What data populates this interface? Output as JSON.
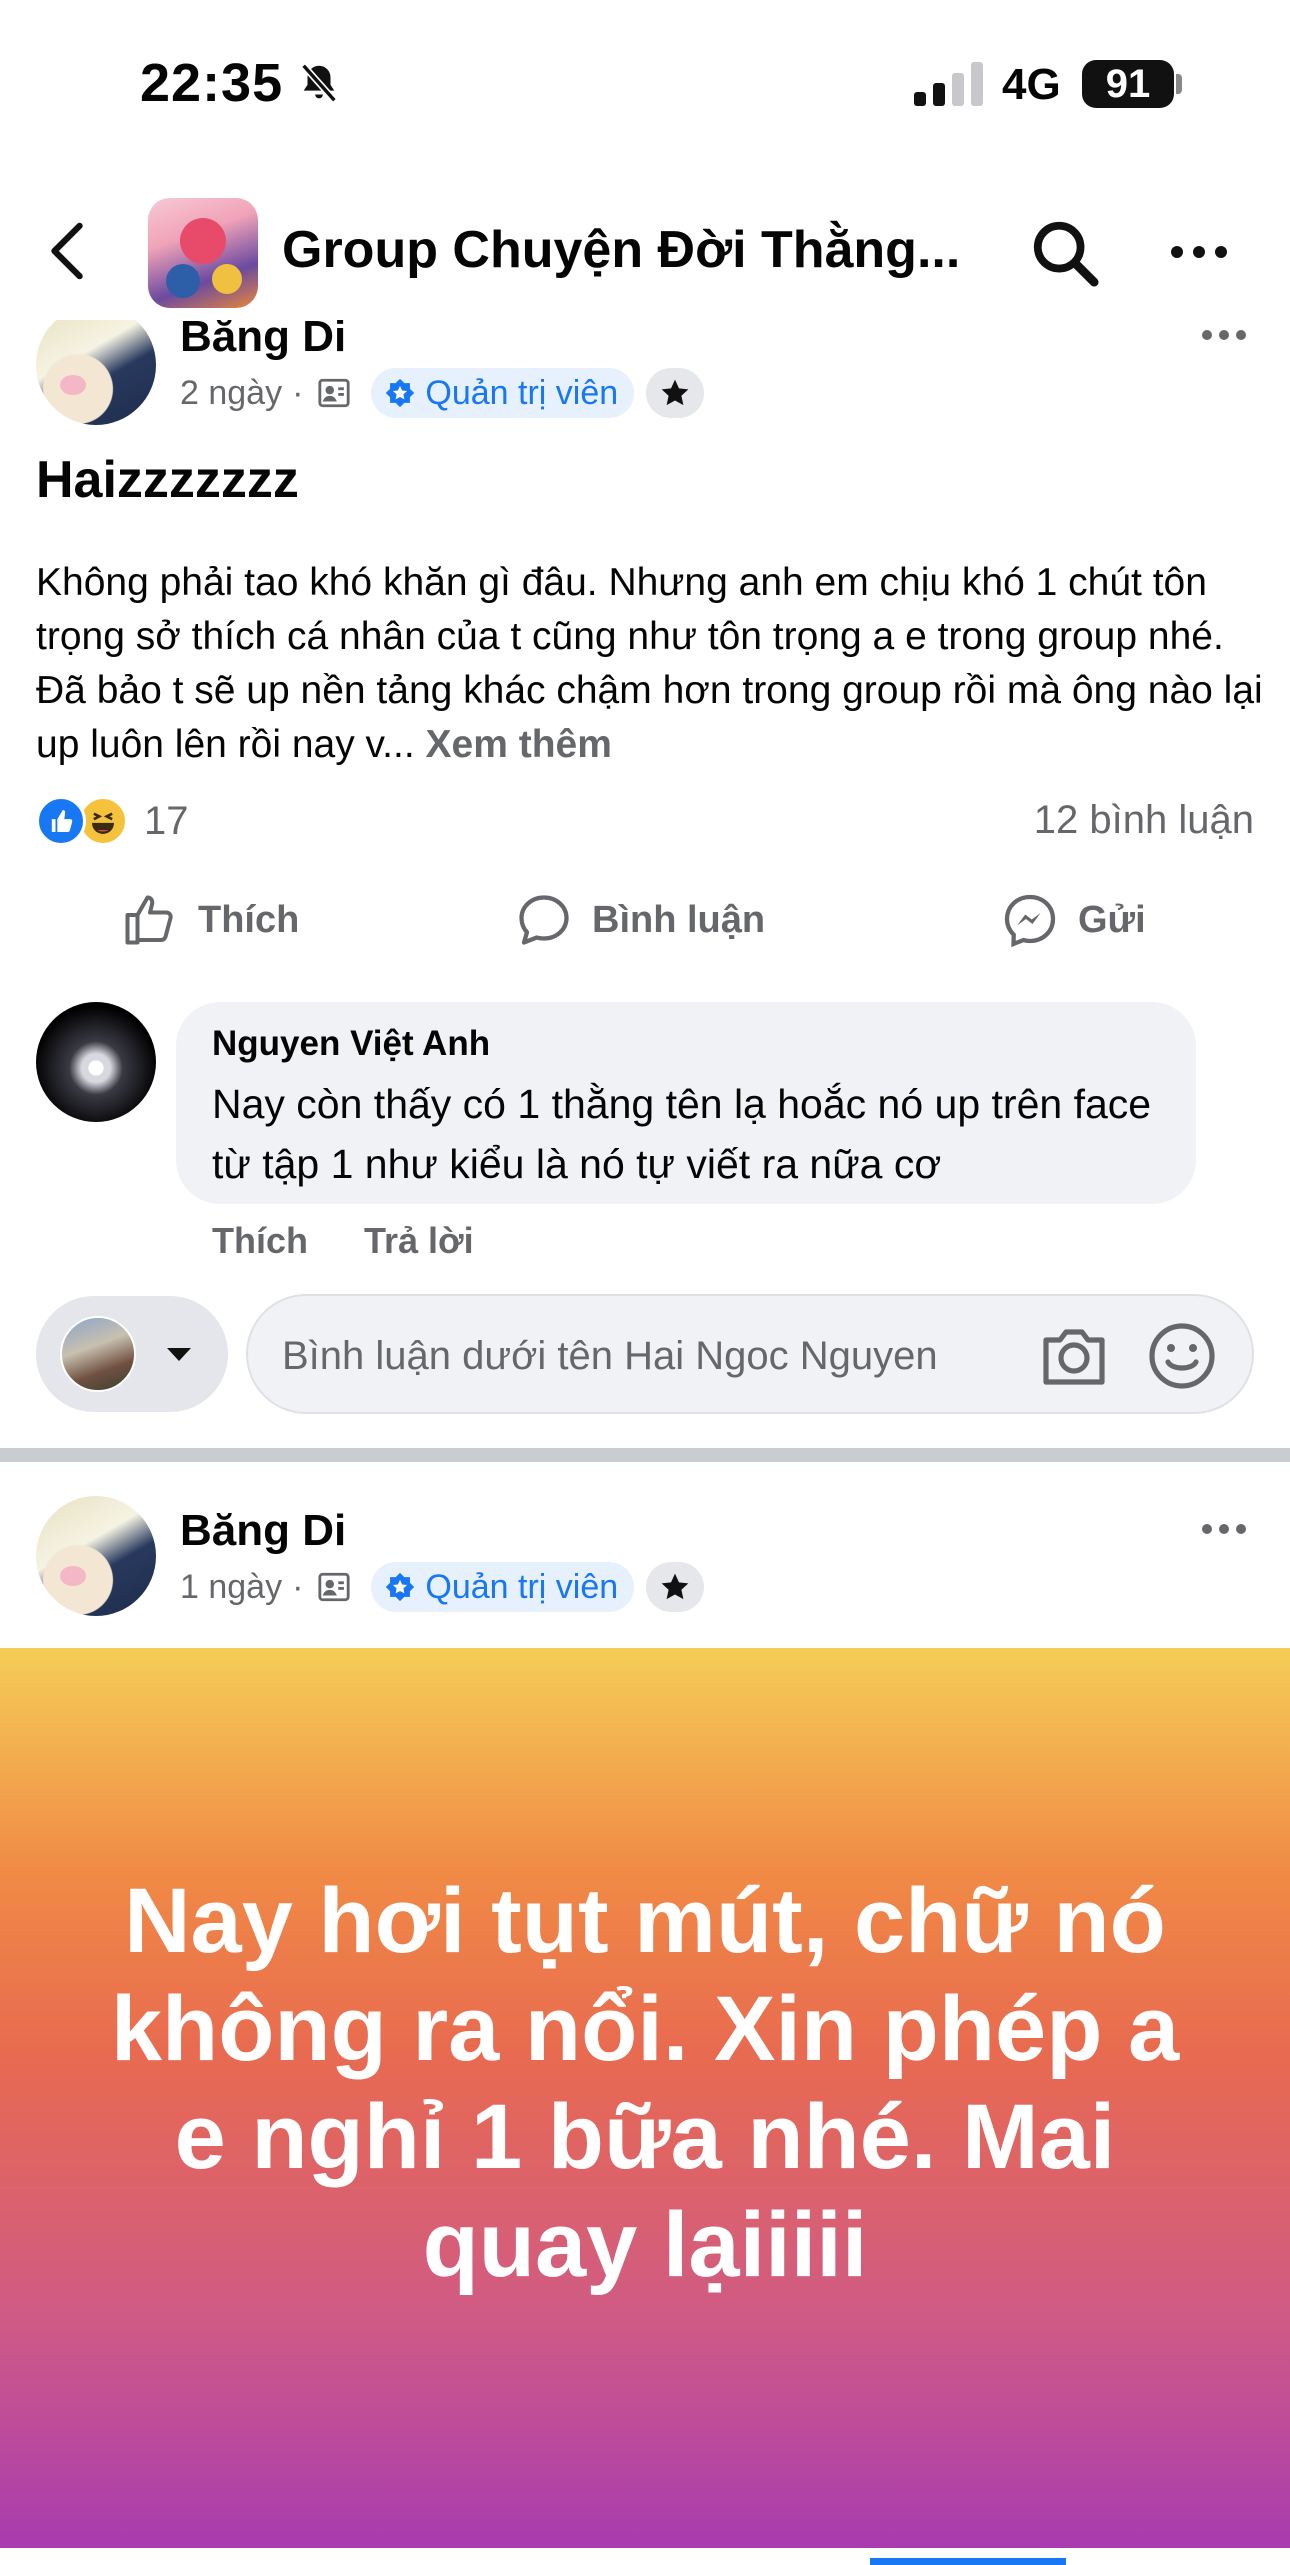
{
  "status_bar": {
    "time": "22:35",
    "network": "4G",
    "battery": "91",
    "icons": [
      "bell-slash-icon",
      "signal-icon"
    ]
  },
  "header": {
    "title": "Group Chuyện Đời Thằng...",
    "icons": [
      "back-icon",
      "search-icon",
      "more-icon"
    ]
  },
  "post1": {
    "author": "Băng Di",
    "time": "2 ngày",
    "separator": "·",
    "role": "Quản trị viên",
    "headline": "Haizzzzzzz",
    "body": "Không phải tao khó khăn gì đâu. Nhưng anh em chịu khó 1 chút tôn trọng sở thích cá nhân của t cũng như tôn trọng a e trong group nhé. Đã bảo t sẽ up nền tảng khác chậm hơn trong group rồi mà ông nào lại up luôn lên rồi nay v...",
    "see_more": "Xem thêm",
    "reaction_count": "17",
    "comment_count": "12 bình luận",
    "actions": {
      "like": "Thích",
      "comment": "Bình luận",
      "send": "Gửi"
    }
  },
  "comment": {
    "author": "Nguyen Việt Anh",
    "text": "Nay còn thấy có 1 thằng tên lạ hoắc nó up trên face từ tập 1 như kiểu là nó tự viết ra nữa cơ",
    "like": "Thích",
    "reply": "Trả lời"
  },
  "composer": {
    "placeholder": "Bình luận dưới tên Hai Ngoc Nguyen"
  },
  "post2": {
    "author": "Băng Di",
    "time": "1 ngày",
    "separator": "·",
    "role": "Quản trị viên",
    "background_text": "Nay hơi tụt mút, chữ nó không ra nổi. Xin phép a e nghỉ 1 bữa nhé. Mai quay lạiiiii"
  },
  "colors": {
    "accent": "#1877f2",
    "secondary_text": "#65676b",
    "bg_gradient_top": "#f5cd57",
    "bg_gradient_bottom": "#a83bb0"
  }
}
